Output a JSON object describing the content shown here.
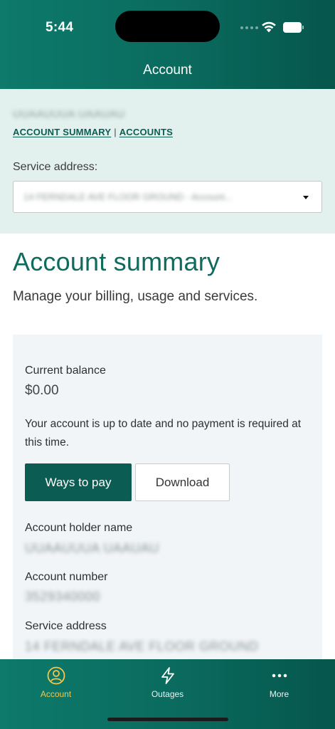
{
  "status_bar": {
    "time": "5:44"
  },
  "nav": {
    "title": "Account"
  },
  "account_selector": {
    "holder_name": "UUAAUUUA UAAUAU",
    "breadcrumb": {
      "summary_link": "ACCOUNT SUMMARY",
      "separator": "|",
      "accounts_link": "ACCOUNTS"
    },
    "service_label": "Service address:",
    "selected_address": "14 FERNDALE AVE FLOOR GROUND - Account..."
  },
  "summary": {
    "title": "Account summary",
    "subtitle": "Manage your billing, usage and services."
  },
  "card": {
    "balance_label": "Current balance",
    "balance_value": "$0.00",
    "status_message": "Your account is up to date and no payment is required at this time.",
    "primary_button": "Ways to pay",
    "secondary_button": "Download",
    "holder_label": "Account holder name",
    "holder_value": "UUAAUUUA UAAUAU",
    "number_label": "Account number",
    "number_value": "3529340000",
    "address_label": "Service address",
    "address_value": "14 FERNDALE AVE FLOOR GROUND"
  },
  "tab_bar": {
    "tabs": [
      {
        "label": "Account",
        "icon": "user-circle-icon",
        "active": true
      },
      {
        "label": "Outages",
        "icon": "lightning-icon",
        "active": false
      },
      {
        "label": "More",
        "icon": "more-dots-icon",
        "active": false
      }
    ]
  },
  "colors": {
    "brand_green": "#0a6a5d",
    "button_green": "#0b5d53",
    "title_green": "#0f6b5e",
    "selector_bg": "#e3f1ee",
    "card_bg": "#f2f5f8",
    "active_tab": "#f4c64a"
  }
}
